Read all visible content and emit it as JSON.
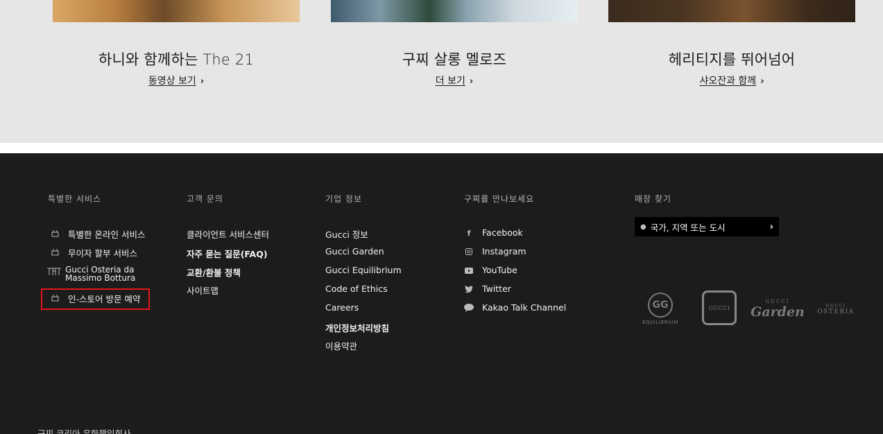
{
  "cards": [
    {
      "title": "하니와 함께하는 The 21",
      "link": "동영상 보기"
    },
    {
      "title": "구찌 살롱 멜로즈",
      "link": "더 보기"
    },
    {
      "title": "헤리티지를 뛰어넘어",
      "link": "샤오잔과 함께"
    }
  ],
  "footer": {
    "special": {
      "title": "특별한 서비스",
      "items": [
        "특별한 온라인 서비스",
        "무이자 할부 서비스",
        "Gucci Osteria da Massimo Bottura",
        "인-스토어 방문 예약"
      ]
    },
    "customer": {
      "title": "고객 문의",
      "items": [
        "클라이언트 서비스센터",
        "자주 묻는 질문(FAQ)",
        "교환/환불 정책",
        "사이트맵"
      ]
    },
    "corporate": {
      "title": "기업 정보",
      "items": [
        "Gucci 정보",
        "Gucci Garden",
        "Gucci Equilibrium",
        "Code of Ethics",
        "Careers",
        "개인정보처리방침",
        "이용약관"
      ]
    },
    "social": {
      "title": "구찌를 만나보세요",
      "items": [
        "Facebook",
        "Instagram",
        "YouTube",
        "Twitter",
        "Kakao Talk Channel"
      ]
    },
    "store": {
      "title": "매장 찾기",
      "placeholder": "국가, 지역 또는 도시"
    },
    "logos": {
      "equilibrium": "EQUILIBRIUM",
      "gucci": "GUCCI",
      "garden_top": "GUCCI",
      "garden": "Garden",
      "osteria_top": "GUCCI",
      "osteria": "OSTERIA"
    },
    "company": "구찌 코리아 유한책임회사"
  }
}
